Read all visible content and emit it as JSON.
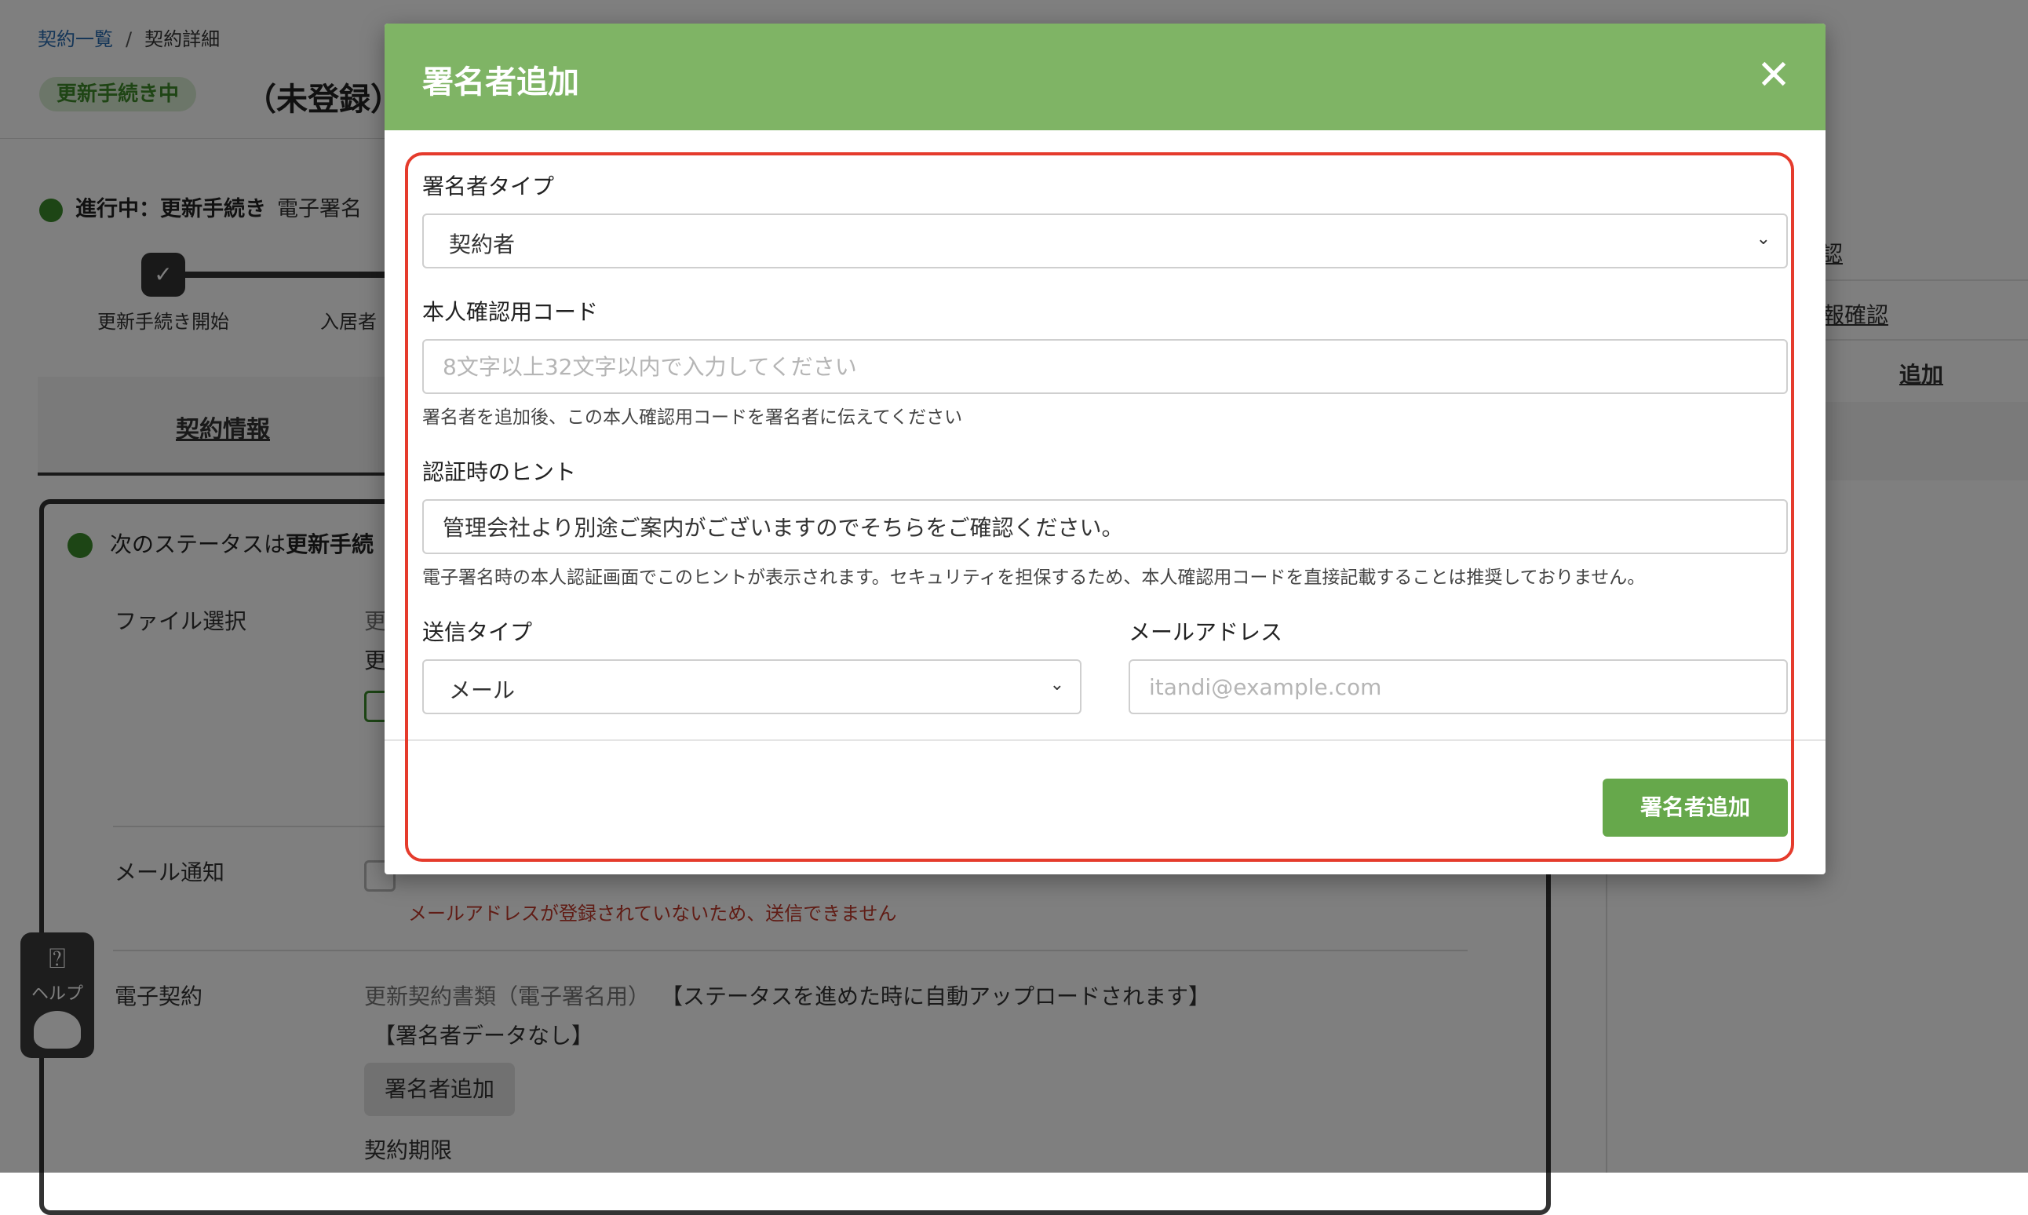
{
  "breadcrumb": {
    "list": "契約一覧",
    "sep": "/",
    "current": "契約詳細"
  },
  "header": {
    "status": "更新手続き中",
    "title": "（未登録）"
  },
  "progress": {
    "title": "進行中：更新手続き",
    "sub": "電子署名",
    "step1": "更新手続き開始",
    "step2": "入居者"
  },
  "tabs": {
    "contract_info": "契約情報"
  },
  "next_status": {
    "prefix": "次のステータスは",
    "bold": "更新手続"
  },
  "rows": {
    "file_select": "ファイル選択",
    "file_select_text1": "更",
    "file_select_text2": "更",
    "mail_notify": "メール通知",
    "mail_warning": "メールアドレスが登録されていないため、送信できません",
    "e_contract": "電子契約",
    "e_contract_doc": "更新契約書類（電子署名用）",
    "e_contract_note": "【ステータスを進めた時に自動アップロードされます】",
    "no_signer": "【署名者データなし】",
    "add_signer": "署名者追加",
    "contract_term": "契約期限"
  },
  "side": {
    "link1": "認",
    "link2": "報確認",
    "link3": "追加"
  },
  "help": {
    "label": "ヘルプ"
  },
  "modal": {
    "title": "署名者追加",
    "close_icon": "close-icon",
    "signer_type": {
      "label": "署名者タイプ",
      "value": "契約者"
    },
    "auth_code": {
      "label": "本人確認用コード",
      "placeholder": "8文字以上32文字以内で入力してください",
      "help": "署名者を追加後、この本人確認用コードを署名者に伝えてください"
    },
    "hint": {
      "label": "認証時のヒント",
      "value": "管理会社より別途ご案内がございますのでそちらをご確認ください。",
      "help": "電子署名時の本人認証画面でこのヒントが表示されます。セキュリティを担保するため、本人確認用コードを直接記載することは推奨しておりません。"
    },
    "send_type": {
      "label": "送信タイプ",
      "value": "メール"
    },
    "email": {
      "label": "メールアドレス",
      "placeholder": "itandi@example.com"
    },
    "submit": "署名者追加"
  },
  "colors": {
    "header_green": "#7fb465",
    "button_green": "#66a84b",
    "highlight_red": "#e53b2c"
  }
}
